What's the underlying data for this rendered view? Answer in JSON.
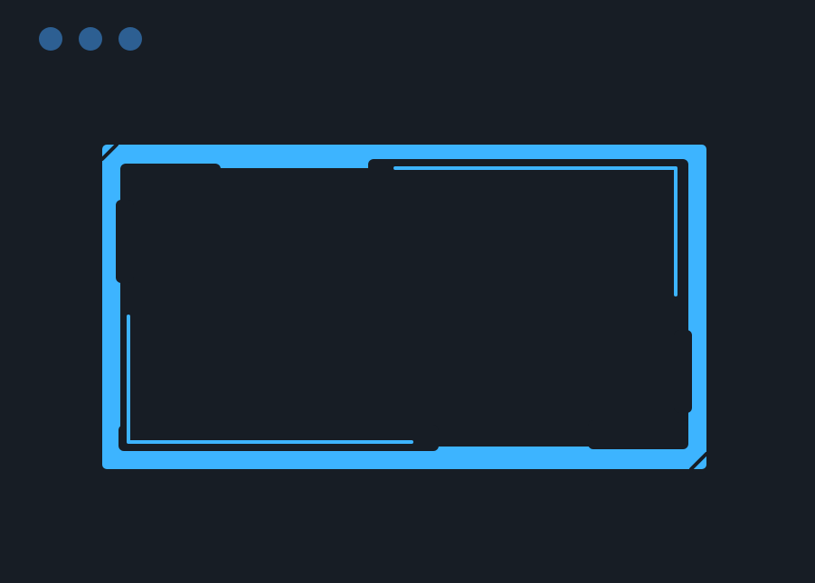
{
  "window": {
    "controls": [
      {
        "name": "window-dot-1"
      },
      {
        "name": "window-dot-2"
      },
      {
        "name": "window-dot-3"
      }
    ]
  },
  "colors": {
    "background": "#171d25",
    "dot": "#2d5f92",
    "accent": "#3db4ff",
    "panel": "#171d25"
  }
}
